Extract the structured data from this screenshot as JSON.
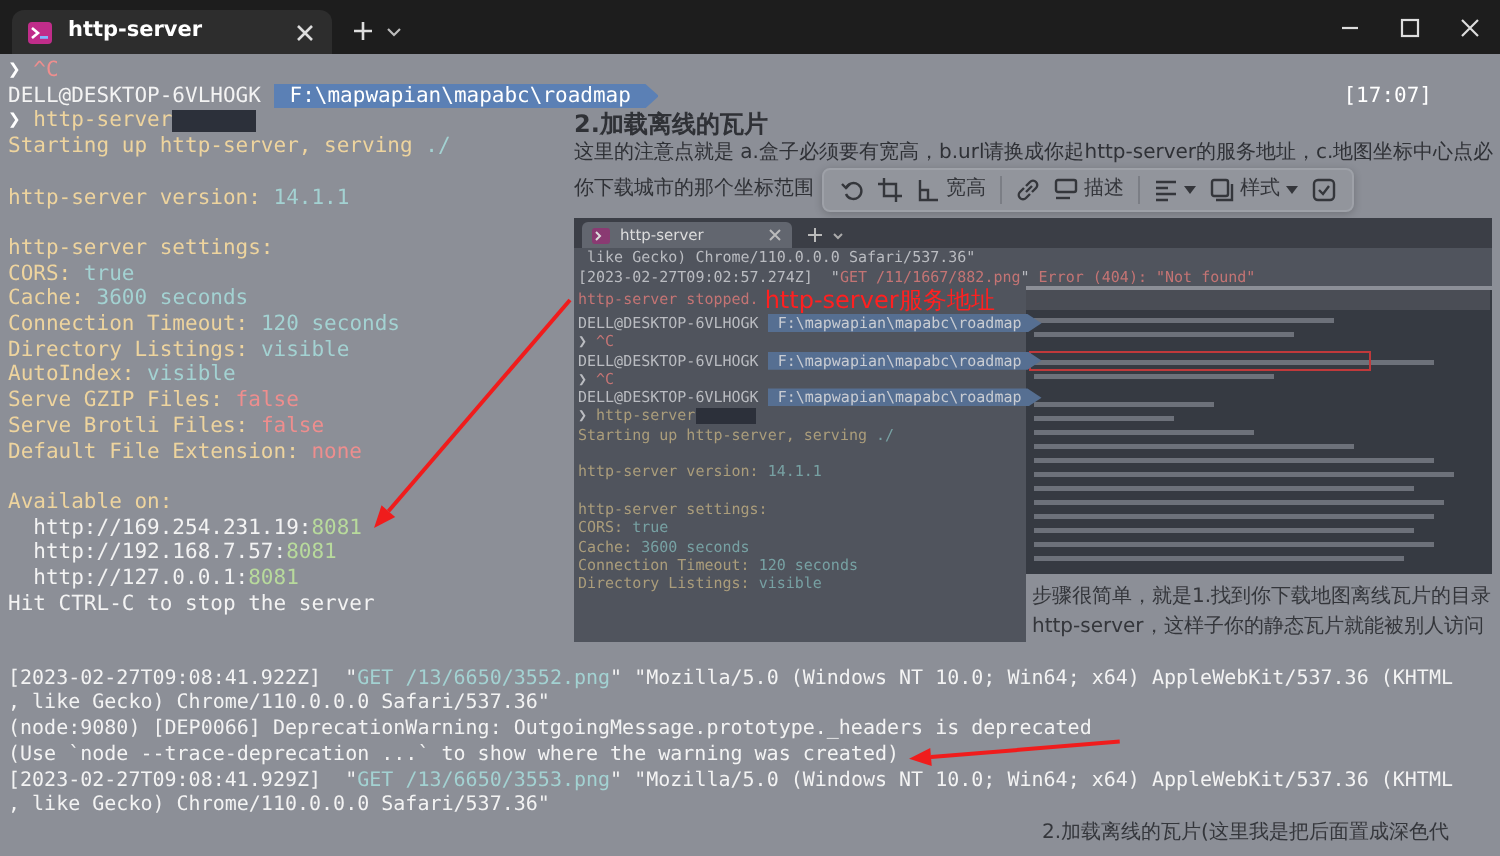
{
  "window": {
    "tab": {
      "title": "http-server",
      "selected": true
    }
  },
  "terminal": {
    "header_lines": [
      {
        "kind": "text",
        "segments": [
          {
            "kind": "prompt",
            "text": "❯"
          },
          {
            "kind": "error",
            "text": " ^C"
          }
        ]
      },
      {
        "kind": "text",
        "segments": [
          {
            "kind": "text",
            "text": "DELL@DESKTOP-6VLHOGK "
          },
          {
            "kind": "path",
            "text": "F:\\mapwapian\\mapabc\\roadmap"
          },
          {
            "kind": "time",
            "text": "[17:07]"
          }
        ]
      }
    ],
    "lines": [
      {
        "kind": "text",
        "segments": [
          {
            "kind": "prompt",
            "text": "❯"
          },
          {
            "kind": "label",
            "text": " http-server"
          },
          {
            "kind": "redacted"
          }
        ]
      },
      {
        "kind": "text",
        "segments": [
          {
            "kind": "label",
            "text": "Starting up http-server, serving "
          },
          {
            "kind": "value",
            "text": "./"
          }
        ]
      },
      {
        "kind": "blank"
      },
      {
        "kind": "text",
        "segments": [
          {
            "kind": "label",
            "text": "http-server version: "
          },
          {
            "kind": "value",
            "text": "14.1.1"
          }
        ]
      },
      {
        "kind": "blank"
      },
      {
        "kind": "text",
        "segments": [
          {
            "kind": "label",
            "text": "http-server settings:"
          }
        ]
      },
      {
        "kind": "text",
        "segments": [
          {
            "kind": "label",
            "text": "CORS: "
          },
          {
            "kind": "value",
            "text": "true"
          }
        ]
      },
      {
        "kind": "text",
        "segments": [
          {
            "kind": "label",
            "text": "Cache: "
          },
          {
            "kind": "value",
            "text": "3600 seconds"
          }
        ]
      },
      {
        "kind": "text",
        "segments": [
          {
            "kind": "label",
            "text": "Connection Timeout: "
          },
          {
            "kind": "value",
            "text": "120 seconds"
          }
        ]
      },
      {
        "kind": "text",
        "segments": [
          {
            "kind": "label",
            "text": "Directory Listings: "
          },
          {
            "kind": "value",
            "text": "visible"
          }
        ]
      },
      {
        "kind": "text",
        "segments": [
          {
            "kind": "label",
            "text": "AutoIndex: "
          },
          {
            "kind": "value",
            "text": "visible"
          }
        ]
      },
      {
        "kind": "text",
        "segments": [
          {
            "kind": "label",
            "text": "Serve GZIP Files: "
          },
          {
            "kind": "error",
            "text": "false"
          }
        ]
      },
      {
        "kind": "text",
        "segments": [
          {
            "kind": "label",
            "text": "Serve Brotli Files: "
          },
          {
            "kind": "error",
            "text": "false"
          }
        ]
      },
      {
        "kind": "text",
        "segments": [
          {
            "kind": "label",
            "text": "Default File Extension: "
          },
          {
            "kind": "error",
            "text": "none"
          }
        ]
      },
      {
        "kind": "blank"
      },
      {
        "kind": "text",
        "segments": [
          {
            "kind": "label",
            "text": "Available on:"
          }
        ]
      },
      {
        "kind": "text",
        "segments": [
          {
            "kind": "text",
            "text": "  http://169.254.231.19:"
          },
          {
            "kind": "port",
            "text": "8081"
          }
        ]
      },
      {
        "kind": "text",
        "segments": [
          {
            "kind": "text",
            "text": "  http://192.168.7.57:"
          },
          {
            "kind": "port",
            "text": "8081"
          }
        ]
      },
      {
        "kind": "text",
        "segments": [
          {
            "kind": "text",
            "text": "  http://127.0.0.1:"
          },
          {
            "kind": "port",
            "text": "8081"
          }
        ]
      },
      {
        "kind": "text",
        "segments": [
          {
            "kind": "text",
            "text": "Hit CTRL-C to stop the server"
          }
        ]
      }
    ],
    "log_lines": [
      {
        "kind": "text",
        "segments": [
          {
            "kind": "text",
            "text": "[2023-02-27T09:08:41.922Z]  \""
          },
          {
            "kind": "value",
            "text": "GET /13/6650/3552.png"
          },
          {
            "kind": "text",
            "text": "\" \"Mozilla/5.0 (Windows NT 10.0; Win64; x64) AppleWebKit/537.36 (KHTML"
          }
        ]
      },
      {
        "kind": "text",
        "segments": [
          {
            "kind": "text",
            "text": ", like Gecko) Chrome/110.0.0.0 Safari/537.36\""
          }
        ]
      },
      {
        "kind": "text",
        "segments": [
          {
            "kind": "text",
            "text": "(node:9080) [DEP0066] DeprecationWarning: OutgoingMessage.prototype._headers is deprecated"
          }
        ]
      },
      {
        "kind": "text",
        "segments": [
          {
            "kind": "text",
            "text": "(Use `node --trace-deprecation ...` to show where the warning was created)"
          }
        ]
      },
      {
        "kind": "text",
        "segments": [
          {
            "kind": "text",
            "text": "[2023-02-27T09:08:41.929Z]  \""
          },
          {
            "kind": "value",
            "text": "GET /13/6650/3553.png"
          },
          {
            "kind": "text",
            "text": "\" \"Mozilla/5.0 (Windows NT 10.0; Win64; x64) AppleWebKit/537.36 (KHTML"
          }
        ]
      },
      {
        "kind": "text",
        "segments": [
          {
            "kind": "text",
            "text": ", like Gecko) Chrome/110.0.0.0 Safari/537.36\""
          }
        ]
      }
    ]
  },
  "page_behind": {
    "heading": "2.加载离线的瓦片",
    "paragraph": "这里的注意点就是 a.盒子必须要有宽高，b.url请换成你起http-server的服务地址，c.地图坐标中心点必",
    "paragraph_2": "你下载城市的那个坐标范围",
    "toolbar": {
      "buttons": [
        {
          "label": "宽高"
        },
        {
          "label": "描述"
        },
        {
          "label": "样式"
        }
      ]
    },
    "screenshot": {
      "tab": {
        "title": "http-server",
        "selected": true
      },
      "top_lines": [
        {
          "kind": "text",
          "segments": [
            {
              "kind": "text",
              "text": " like Gecko) Chrome/110.0.0.0 Safari/537.36\""
            }
          ]
        },
        {
          "kind": "text",
          "segments": [
            {
              "kind": "text",
              "text": "[2023-02-27T09:02:57.274Z]  \""
            },
            {
              "kind": "error",
              "text": "GET /11/1667/882.png"
            },
            {
              "kind": "text",
              "text": "\" "
            },
            {
              "kind": "error",
              "text": "Error (404): \"Not found\""
            }
          ]
        }
      ],
      "lines": [
        {
          "kind": "text",
          "segments": [
            {
              "kind": "error",
              "text": "http-server stopped."
            },
            {
              "kind": "annotation",
              "text": "http-server服务地址"
            }
          ]
        },
        {
          "kind": "text",
          "segments": [
            {
              "kind": "text",
              "text": "DELL@DESKTOP-6VLHOGK "
            },
            {
              "kind": "path",
              "text": "F:\\mapwapian\\mapabc\\roadmap"
            }
          ]
        },
        {
          "kind": "text",
          "segments": [
            {
              "kind": "prompt",
              "text": "❯"
            },
            {
              "kind": "error",
              "text": " ^C"
            }
          ]
        },
        {
          "kind": "text",
          "segments": [
            {
              "kind": "text",
              "text": "DELL@DESKTOP-6VLHOGK "
            },
            {
              "kind": "path",
              "text": "F:\\mapwapian\\mapabc\\roadmap"
            }
          ]
        },
        {
          "kind": "text",
          "segments": [
            {
              "kind": "prompt",
              "text": "❯"
            },
            {
              "kind": "error",
              "text": " ^C"
            }
          ]
        },
        {
          "kind": "text",
          "segments": [
            {
              "kind": "text",
              "text": "DELL@DESKTOP-6VLHOGK "
            },
            {
              "kind": "path",
              "text": "F:\\mapwapian\\mapabc\\roadmap"
            }
          ]
        },
        {
          "kind": "text",
          "segments": [
            {
              "kind": "prompt",
              "text": "❯"
            },
            {
              "kind": "label",
              "text": " http-server"
            },
            {
              "kind": "redacted"
            }
          ]
        },
        {
          "kind": "text",
          "segments": [
            {
              "kind": "label",
              "text": "Starting up http-server, serving "
            },
            {
              "kind": "value",
              "text": "./"
            }
          ]
        },
        {
          "kind": "blank"
        },
        {
          "kind": "text",
          "segments": [
            {
              "kind": "label",
              "text": "http-server version: "
            },
            {
              "kind": "value",
              "text": "14.1.1"
            }
          ]
        },
        {
          "kind": "blank"
        },
        {
          "kind": "text",
          "segments": [
            {
              "kind": "label",
              "text": "http-server settings:"
            }
          ]
        },
        {
          "kind": "text",
          "segments": [
            {
              "kind": "label",
              "text": "CORS: "
            },
            {
              "kind": "value",
              "text": "true"
            }
          ]
        },
        {
          "kind": "text",
          "segments": [
            {
              "kind": "label",
              "text": "Cache: "
            },
            {
              "kind": "value",
              "text": "3600 seconds"
            }
          ]
        },
        {
          "kind": "text",
          "segments": [
            {
              "kind": "label",
              "text": "Connection Timeout: "
            },
            {
              "kind": "value",
              "text": "120 seconds"
            }
          ]
        },
        {
          "kind": "text",
          "segments": [
            {
              "kind": "label",
              "text": "Directory Listings: "
            },
            {
              "kind": "value",
              "text": "visible"
            }
          ]
        }
      ]
    },
    "side_text": [
      "步骤很简单，就是1.找到你下载地图离线瓦片的目录",
      "http-server，这样子你的静态瓦片就能被别人访问"
    ],
    "footer_text": "2.加载离线的瓦片(这里我是把后面置成深色代"
  }
}
